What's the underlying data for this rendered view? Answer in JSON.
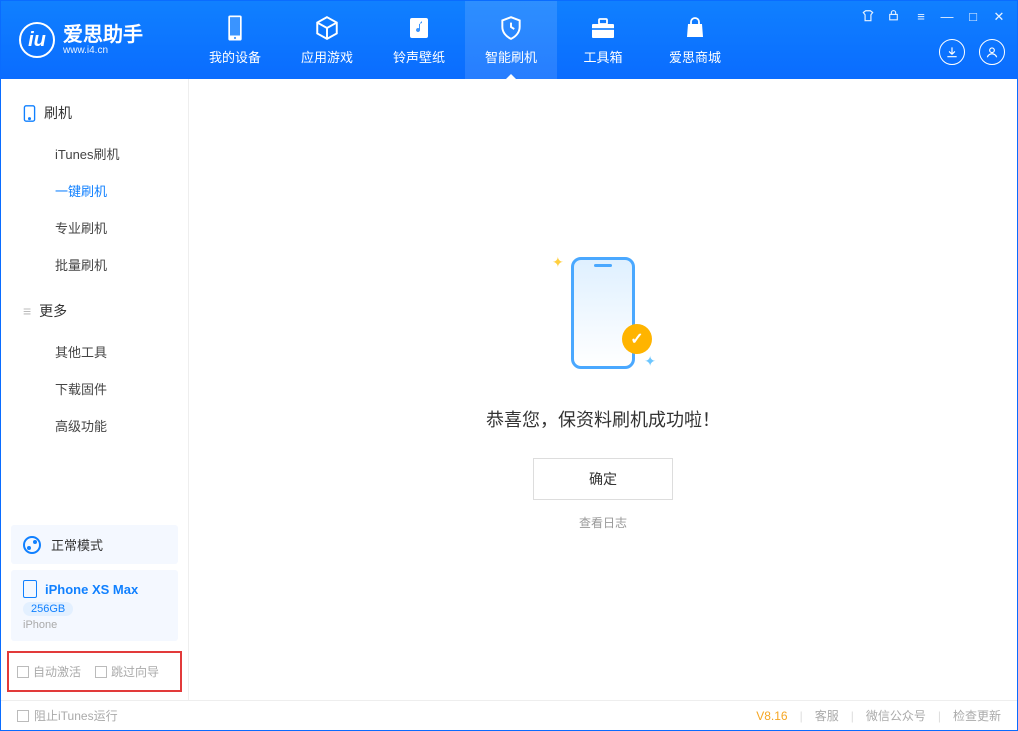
{
  "brand": {
    "name": "爱思助手",
    "url": "www.i4.cn"
  },
  "header_tabs": [
    {
      "id": "device",
      "label": "我的设备",
      "icon": "phone"
    },
    {
      "id": "apps",
      "label": "应用游戏",
      "icon": "cube"
    },
    {
      "id": "ring",
      "label": "铃声壁纸",
      "icon": "note"
    },
    {
      "id": "flash",
      "label": "智能刷机",
      "icon": "shield",
      "active": true
    },
    {
      "id": "tools",
      "label": "工具箱",
      "icon": "toolbox"
    },
    {
      "id": "store",
      "label": "爱思商城",
      "icon": "bag"
    }
  ],
  "sidebar": {
    "groups": [
      {
        "title": "刷机",
        "icon": "phone",
        "items": [
          {
            "label": "iTunes刷机"
          },
          {
            "label": "一键刷机",
            "active": true
          },
          {
            "label": "专业刷机"
          },
          {
            "label": "批量刷机"
          }
        ]
      },
      {
        "title": "更多",
        "icon": "menu",
        "items": [
          {
            "label": "其他工具"
          },
          {
            "label": "下载固件"
          },
          {
            "label": "高级功能"
          }
        ]
      }
    ],
    "mode_label": "正常模式",
    "device": {
      "name": "iPhone XS Max",
      "storage": "256GB",
      "type": "iPhone"
    },
    "options": {
      "auto_activate": "自动激活",
      "skip_guide": "跳过向导"
    }
  },
  "main": {
    "success_msg": "恭喜您，保资料刷机成功啦！",
    "ok_label": "确定",
    "log_link": "查看日志"
  },
  "footer": {
    "block_itunes": "阻止iTunes运行",
    "version": "V8.16",
    "links": [
      "客服",
      "微信公众号",
      "检查更新"
    ]
  }
}
